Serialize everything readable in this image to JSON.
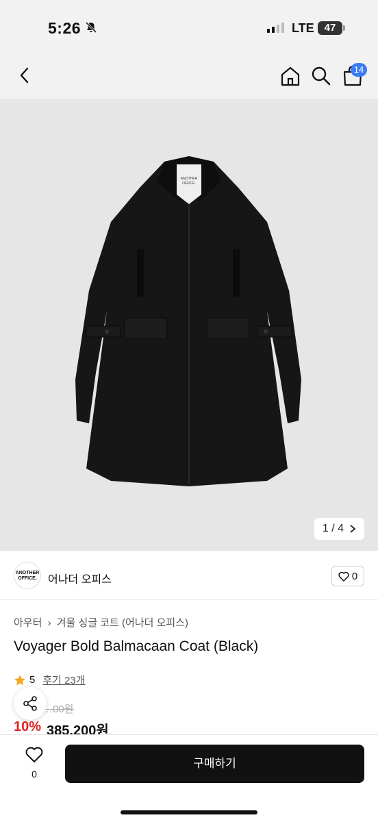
{
  "status_bar": {
    "time": "5:26",
    "network": "LTE",
    "battery": "47"
  },
  "nav": {
    "cart_count": "14"
  },
  "gallery": {
    "counter": "1 / 4"
  },
  "brand": {
    "name": "어나더 오피스",
    "logo_text": "ANOTHER OFFICE.",
    "likes": "0"
  },
  "breadcrumb": [
    "아우터",
    "겨울 싱글 코트 (어나더 오피스)"
  ],
  "product": {
    "title": "Voyager Bold Balmacaan Coat (Black)",
    "rating": "5",
    "reviews_label": "후기 23개",
    "original_price": "…00원",
    "discount": "10%",
    "price": "385,200원"
  },
  "bottom_bar": {
    "wish_count": "0",
    "buy_label": "구매하기"
  },
  "colors": {
    "accent_badge": "#3b7bf5",
    "discount": "#e0241c",
    "buy_button": "#111111"
  }
}
